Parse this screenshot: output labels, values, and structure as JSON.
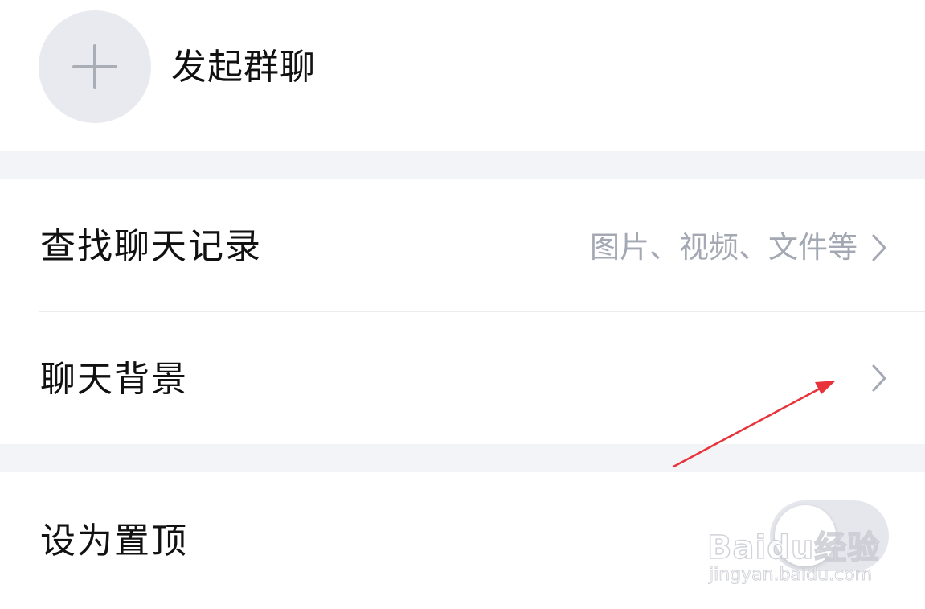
{
  "group_chat": {
    "label": "发起群聊",
    "icon": "plus-icon"
  },
  "search_history": {
    "label": "查找聊天记录",
    "hint": "图片、视频、文件等",
    "icon": "chevron-right-icon"
  },
  "chat_background": {
    "label": "聊天背景",
    "icon": "chevron-right-icon"
  },
  "pin_to_top": {
    "label": "设为置顶",
    "toggle_on": false
  },
  "watermark": {
    "brand": "Baidu经验",
    "url": "jingyan.baidu.com"
  },
  "colors": {
    "separator": "#f3f4f8",
    "hint_text": "#a3a8b3",
    "annotation_arrow": "#e8333a"
  }
}
